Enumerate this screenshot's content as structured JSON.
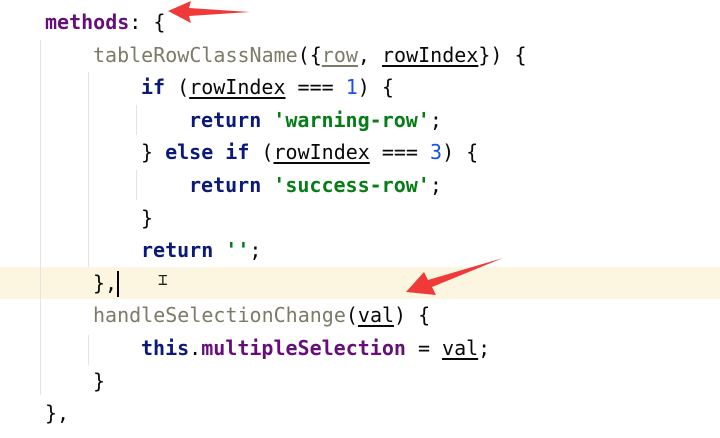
{
  "editor": {
    "lines": [
      {
        "tokens": [
          {
            "t": "methods",
            "c": "prop"
          },
          {
            "t": ": {",
            "c": ""
          }
        ]
      },
      {
        "tokens": [
          {
            "t": "tableRowClassName",
            "c": "fn"
          },
          {
            "t": "({",
            "c": ""
          },
          {
            "t": "row",
            "c": "param unused"
          },
          {
            "t": ", ",
            "c": ""
          },
          {
            "t": "rowIndex",
            "c": "param"
          },
          {
            "t": "}) {",
            "c": ""
          }
        ]
      },
      {
        "tokens": [
          {
            "t": "if",
            "c": "kw"
          },
          {
            "t": " (",
            "c": ""
          },
          {
            "t": "rowIndex",
            "c": "param"
          },
          {
            "t": " === ",
            "c": ""
          },
          {
            "t": "1",
            "c": "num"
          },
          {
            "t": ") {",
            "c": ""
          }
        ]
      },
      {
        "tokens": [
          {
            "t": "return",
            "c": "kw"
          },
          {
            "t": " ",
            "c": ""
          },
          {
            "t": "'warning-row'",
            "c": "str"
          },
          {
            "t": ";",
            "c": ""
          }
        ]
      },
      {
        "tokens": [
          {
            "t": "} ",
            "c": ""
          },
          {
            "t": "else if",
            "c": "kw"
          },
          {
            "t": " (",
            "c": ""
          },
          {
            "t": "rowIndex",
            "c": "param"
          },
          {
            "t": " === ",
            "c": ""
          },
          {
            "t": "3",
            "c": "num"
          },
          {
            "t": ") {",
            "c": ""
          }
        ]
      },
      {
        "tokens": [
          {
            "t": "return",
            "c": "kw"
          },
          {
            "t": " ",
            "c": ""
          },
          {
            "t": "'success-row'",
            "c": "str"
          },
          {
            "t": ";",
            "c": ""
          }
        ]
      },
      {
        "tokens": [
          {
            "t": "}",
            "c": ""
          }
        ]
      },
      {
        "tokens": [
          {
            "t": "return",
            "c": "kw"
          },
          {
            "t": " ",
            "c": ""
          },
          {
            "t": "''",
            "c": "str"
          },
          {
            "t": ";",
            "c": ""
          }
        ]
      },
      {
        "tokens": [
          {
            "t": "},",
            "c": ""
          }
        ],
        "caret": true
      },
      {
        "tokens": [
          {
            "t": "handleSelectionChange",
            "c": "fn"
          },
          {
            "t": "(",
            "c": ""
          },
          {
            "t": "val",
            "c": "param"
          },
          {
            "t": ") {",
            "c": ""
          }
        ]
      },
      {
        "tokens": [
          {
            "t": "this",
            "c": "kw"
          },
          {
            "t": ".",
            "c": ""
          },
          {
            "t": "multipleSelection",
            "c": "prop"
          },
          {
            "t": " = ",
            "c": ""
          },
          {
            "t": "val",
            "c": "param"
          },
          {
            "t": ";",
            "c": ""
          }
        ]
      },
      {
        "tokens": [
          {
            "t": "}",
            "c": ""
          }
        ]
      },
      {
        "tokens": [
          {
            "t": "},",
            "c": ""
          }
        ]
      }
    ],
    "indents": [
      0,
      1,
      2,
      3,
      2,
      3,
      2,
      2,
      1,
      1,
      2,
      1,
      0
    ],
    "colors": {
      "current_line": "#fcf5df",
      "annotation_arrow": "#f03a3a"
    }
  }
}
